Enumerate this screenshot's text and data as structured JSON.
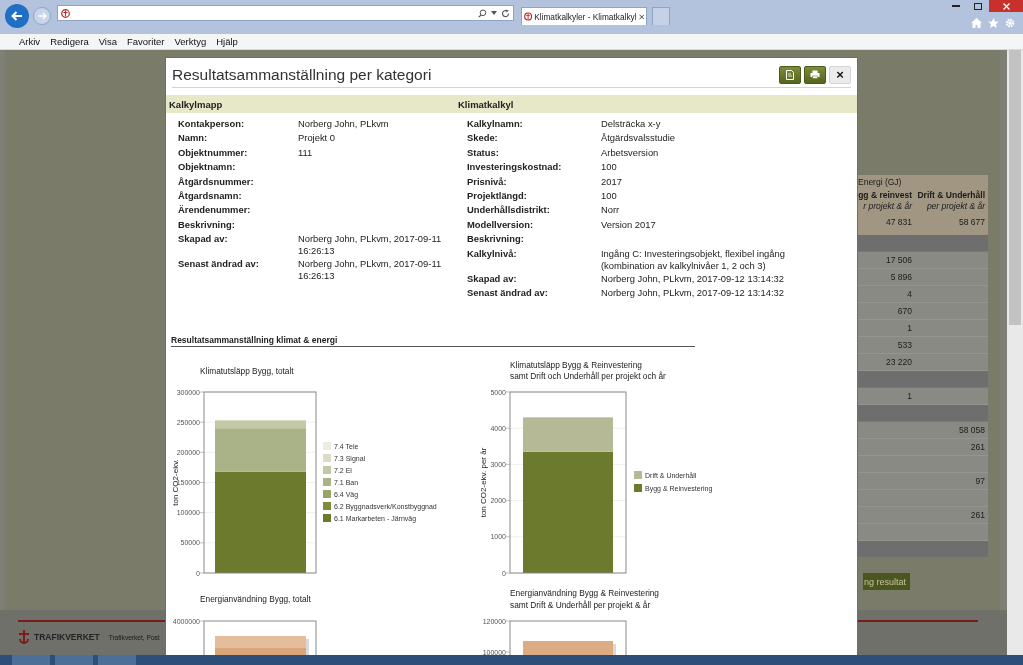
{
  "browser": {
    "tab_title": "Klimatkalkyler - Klimatkalkyl",
    "menu": [
      "Arkiv",
      "Redigera",
      "Visa",
      "Favoriter",
      "Verktyg",
      "Hjälp"
    ]
  },
  "background": {
    "table": {
      "group_heading": "Energi (GJ)",
      "columns": [
        {
          "title": "gg & reinvest",
          "subtitle": "r projekt & år"
        },
        {
          "title": "Drift & Underhåll",
          "subtitle": "per projekt & år"
        }
      ],
      "total": [
        "47 831",
        "58 677"
      ],
      "rows": [
        {
          "kind": "section"
        },
        {
          "kind": "data",
          "col_1": "17 506"
        },
        {
          "kind": "data",
          "col_1": "5 896"
        },
        {
          "kind": "data",
          "col_1": "4"
        },
        {
          "kind": "data",
          "col_1": "670"
        },
        {
          "kind": "data",
          "col_1": "1"
        },
        {
          "kind": "data",
          "col_1": "533"
        },
        {
          "kind": "data",
          "col_1": "23 220"
        },
        {
          "kind": "section"
        },
        {
          "kind": "data",
          "col_1": "1"
        },
        {
          "kind": "section"
        },
        {
          "kind": "data",
          "col_2": "58 058"
        },
        {
          "kind": "data",
          "col_2": "261"
        },
        {
          "kind": "data"
        },
        {
          "kind": "data",
          "col_2": "97"
        },
        {
          "kind": "data"
        },
        {
          "kind": "data",
          "col_2": "261"
        },
        {
          "kind": "data"
        },
        {
          "kind": "section"
        }
      ]
    },
    "button": "ng resultat",
    "footer": {
      "logo": "TRAFIKVERKET",
      "address": "Trafikverket, Post"
    }
  },
  "dialog": {
    "title": "Resultatsammanställning per kategori",
    "buttons": [
      {
        "kind": "pdf"
      },
      {
        "kind": "print"
      },
      {
        "kind": "close",
        "label": "×"
      }
    ],
    "info": [
      {
        "heading": "Kalkylmapp",
        "rows": [
          {
            "label": "Kontakperson:",
            "value": "Norberg John, PLkvm"
          },
          {
            "label": "Namn:",
            "value": "Projekt 0"
          },
          {
            "label": "Objektnummer:",
            "value": "111"
          },
          {
            "label": "Objektnamn:"
          },
          {
            "label": "Åtgärdsnummer:"
          },
          {
            "label": "Åtgardsnamn:"
          },
          {
            "label": "Ärendenummer:"
          },
          {
            "label": "Beskrivning:"
          },
          {
            "label": "Skapad av:",
            "value": "Norberg John, PLkvm, 2017-09-11\n16:26:13"
          },
          {
            "label": "Senast ändrad av:",
            "value": "Norberg John, PLkvm, 2017-09-11\n16:26:13"
          }
        ]
      },
      {
        "heading": "Klimatkalkyl",
        "rows": [
          {
            "label": "Kalkylnamn:",
            "value": "Delsträcka x-y"
          },
          {
            "label": "Skede:",
            "value": "Åtgärdsvalsstudie"
          },
          {
            "label": "Status:",
            "value": "Arbetsversion"
          },
          {
            "label": "Investeringskostnad:",
            "value": "100"
          },
          {
            "label": "Prisnivå:",
            "value": "2017"
          },
          {
            "label": "Projektlängd:",
            "value": "100"
          },
          {
            "label": "Underhållsdistrikt:",
            "value": "Norr"
          },
          {
            "label": "Modellversion:",
            "value": "Version 2017"
          },
          {
            "label": "Beskrivning:"
          },
          {
            "label": "Kalkylnivå:",
            "value": "Ingång C: Investeringsobjekt, flexibel ingång\n(kombination av kalkylnivåer 1, 2 och 3)"
          },
          {
            "label": "Skapad av:",
            "value": "Norberg John, PLkvm, 2017-09-12 13:14:32"
          },
          {
            "label": "Senast ändrad av:",
            "value": "Norberg John, PLkvm, 2017-09-12 13:14:32"
          }
        ]
      }
    ],
    "section_title": "Resultatsammanställning klimat & energi",
    "charts": [
      {
        "chart_data": {
          "type": "bar",
          "title": "Klimatutsläpp Bygg, totalt",
          "ylabel": "ton CO2-ekv.",
          "stacked": true,
          "grid": true,
          "legend": true,
          "ylim": [
            0,
            300000
          ],
          "yticks": [
            0,
            50000,
            100000,
            150000,
            200000,
            250000,
            300000
          ],
          "series": [
            {
              "name": "6.1 Markarbeten - Järnväg",
              "color": "#6b7a2c",
              "values": [
                168000
              ]
            },
            {
              "name": "6.2 Byggnadsverk/Konstbyggnad",
              "color": "#7d8c3b",
              "values": [
                0
              ]
            },
            {
              "name": "6.4 Väg",
              "color": "#9aa565",
              "values": [
                0
              ]
            },
            {
              "name": "7.1 Ban",
              "color": "#aab388",
              "values": [
                72000
              ]
            },
            {
              "name": "7.2 El",
              "color": "#c4c8a6",
              "values": [
                13000
              ]
            },
            {
              "name": "7.3 Signal",
              "color": "#dcdcc6",
              "values": [
                0
              ]
            },
            {
              "name": "7.4 Tele",
              "color": "#ececdf",
              "values": [
                0
              ]
            }
          ]
        }
      },
      {
        "chart_data": {
          "type": "bar",
          "title": "Klimatutsläpp Bygg & Reinvestering\nsamt Drift och Underhåll per projekt och år",
          "ylabel": "ton CO2-ekv. per år",
          "stacked": true,
          "grid": true,
          "legend": true,
          "ylim": [
            0,
            5000
          ],
          "yticks": [
            0,
            1000,
            2000,
            3000,
            4000,
            5000
          ],
          "series": [
            {
              "name": "Bygg & Reinvestering",
              "color": "#6b7a2c",
              "values": [
                3350
              ]
            },
            {
              "name": "Drift & Underhåll",
              "color": "#b5b996",
              "values": [
                950
              ]
            }
          ]
        }
      }
    ],
    "energy_charts": [
      {
        "title": "Energianvändning Bygg, totalt",
        "ticks": [
          "4000000"
        ]
      },
      {
        "title": "Energianvändning Bygg & Reinvestering\nsamt Drift & Underhåll per projekt & år",
        "ticks": [
          "120000",
          "100000"
        ]
      }
    ]
  }
}
